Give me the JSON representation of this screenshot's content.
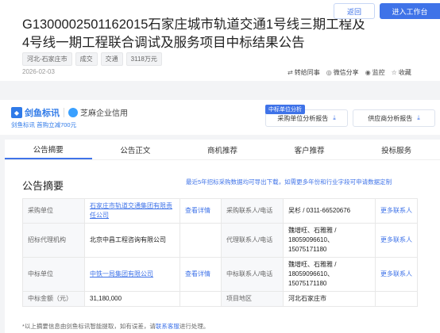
{
  "header": {
    "back_label": "返回",
    "workspace_label": "进入工作台",
    "title": "G1300002501162015石家庄城市轨道交通1号线三期工程及4号线一期工程联合调试及服务项目中标结果公告",
    "tags": [
      "河北-石家庄市",
      "成交",
      "交通",
      "3118万元"
    ],
    "date": "2026-02-03",
    "actions": [
      "转给同事",
      "微信分享",
      "监控",
      "收藏"
    ]
  },
  "company_bar": {
    "brand_jianyu": "剑鱼标讯",
    "brand_zhima": "芝麻企业信用",
    "jianyu_sub": "剑鱼标讯 首购立减700元",
    "report_badge": "中标单位分析",
    "report_btn1": "采购单位分析报告",
    "report_btn2": "供应商分析报告"
  },
  "tabs": [
    "公告摘要",
    "公告正文",
    "商机推荐",
    "客户推荐",
    "投标服务"
  ],
  "summary": {
    "title": "公告摘要",
    "note": "最近5年招标采购数据均可导出下载，如需更多年份和行业字段可申请数据定制",
    "rows": [
      {
        "l1": "采购单位",
        "v1": "石家庄市轨道交通集团有限责任公司",
        "m1": "查看详情",
        "l2": "采购联系人/电话",
        "v2": "吴杉 / 0311-66520676",
        "m2": "更多联系人"
      },
      {
        "l1": "招标代理机构",
        "v1": "北京中昌工程咨询有限公司",
        "m1": "",
        "l2": "代理联系人/电话",
        "v2": "魏增旺、石雅雅 / 18059096610、15075171180",
        "m2": "更多联系人"
      },
      {
        "l1": "中标单位",
        "v1": "中铁一局集团有限公司",
        "m1": "查看详情",
        "l2": "中标联系人/电话",
        "v2": "魏增旺、石雅雅 / 18059096610、15075171180",
        "m2": "更多联系人"
      },
      {
        "l1": "中标金额（元）",
        "v1": "31,180,000",
        "m1": "",
        "l2": "项目地区",
        "v2": "河北石家庄市",
        "m2": ""
      }
    ],
    "footer_prefix": "*以上摘要信息由剑鱼标讯智能提取，如有误差，请",
    "footer_link": "联系客服",
    "footer_suffix": "进行处理。"
  },
  "colors": {
    "accent": "#3f73e8"
  }
}
